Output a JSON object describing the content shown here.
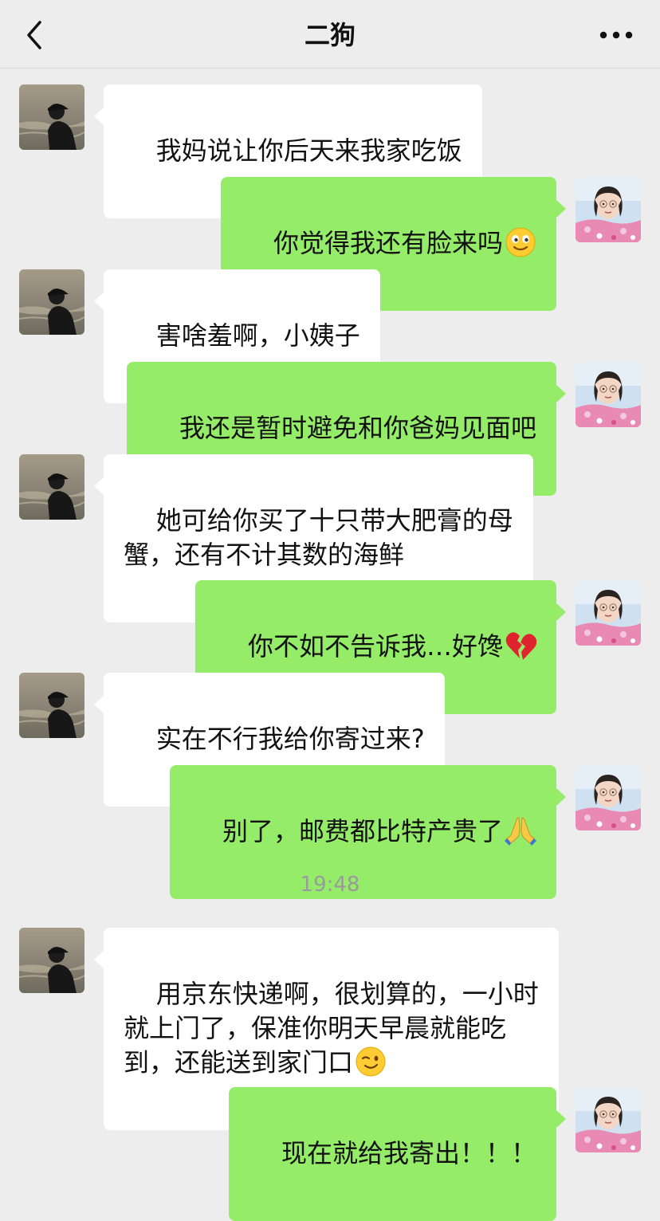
{
  "header": {
    "title": "二狗",
    "back_icon": "chevron-left-icon",
    "more_icon": "more-dots-icon"
  },
  "colors": {
    "background": "#ededed",
    "self_bubble": "#95ec69",
    "other_bubble": "#ffffff"
  },
  "messages": [
    {
      "side": "left",
      "text": "我妈说让你后天来我家吃饭"
    },
    {
      "side": "right",
      "text": "你觉得我还有脸来吗",
      "emoji": "smile-emoji-icon"
    },
    {
      "side": "left",
      "text": "害啥羞啊，小姨子"
    },
    {
      "side": "right",
      "text": "我还是暂时避免和你爸妈见面吧"
    },
    {
      "side": "left",
      "text": "她可给你买了十只带大肥膏的母\n蟹，还有不计其数的海鲜"
    },
    {
      "side": "right",
      "text": "你不如不告诉我…好馋",
      "emoji": "broken-heart-icon"
    },
    {
      "side": "left",
      "text": "实在不行我给你寄过来?"
    },
    {
      "side": "right",
      "text": "别了，邮费都比特产贵了",
      "emoji": "pray-hands-icon"
    },
    {
      "side": "left",
      "text": "用京东快递啊，很划算的，一小时\n就上门了，保准你明天早晨就能吃\n到，还能送到家门口",
      "emoji": "wink-emoji-icon"
    },
    {
      "side": "right",
      "text": "现在就给我寄出！！！"
    }
  ],
  "timestamp": "19:48"
}
